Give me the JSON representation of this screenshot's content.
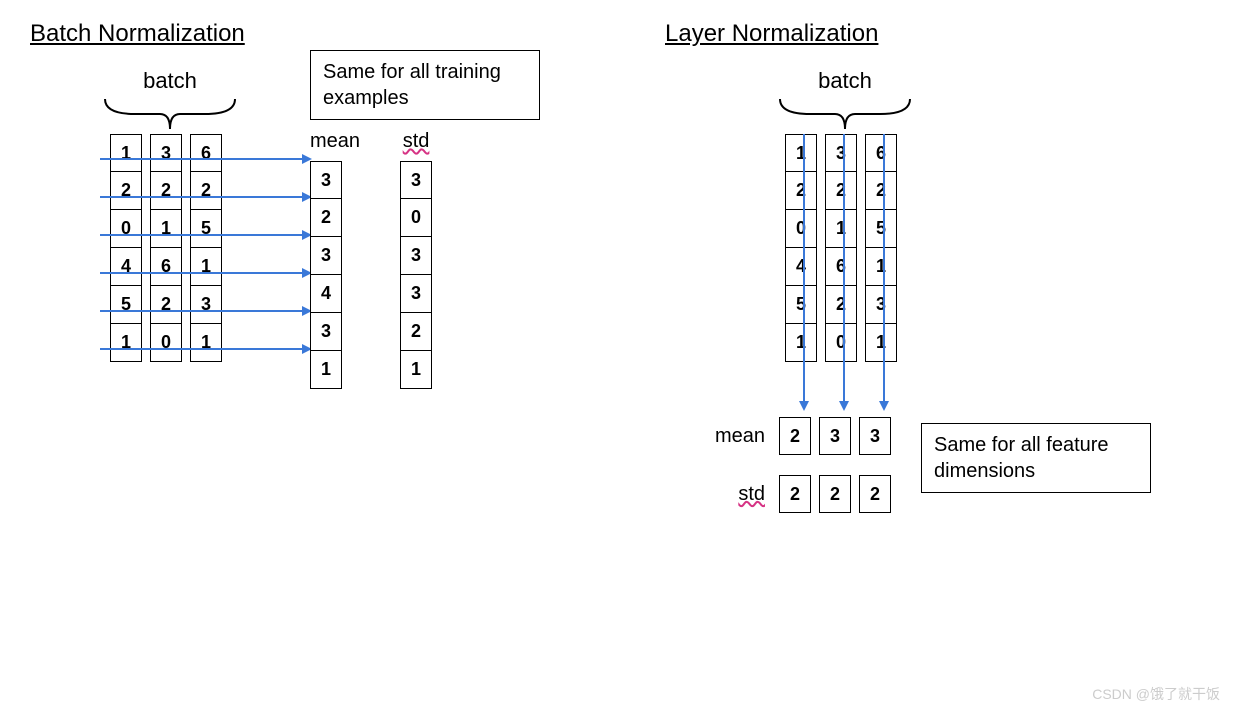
{
  "batch_norm": {
    "title": "Batch Normalization",
    "batch_label": "batch",
    "note": "Same for all training examples",
    "mean_label": "mean",
    "std_label": "std",
    "columns": [
      [
        "1",
        "2",
        "0",
        "4",
        "5",
        "1"
      ],
      [
        "3",
        "2",
        "1",
        "6",
        "2",
        "0"
      ],
      [
        "6",
        "2",
        "5",
        "1",
        "3",
        "1"
      ]
    ],
    "mean": [
      "3",
      "2",
      "3",
      "4",
      "3",
      "1"
    ],
    "std": [
      "3",
      "0",
      "3",
      "3",
      "2",
      "1"
    ]
  },
  "layer_norm": {
    "title": "Layer Normalization",
    "batch_label": "batch",
    "note": "Same for all feature dimensions",
    "mean_label": "mean",
    "std_label": "std",
    "columns": [
      [
        "1",
        "2",
        "0",
        "4",
        "5",
        "1"
      ],
      [
        "3",
        "2",
        "1",
        "6",
        "2",
        "0"
      ],
      [
        "6",
        "2",
        "5",
        "1",
        "3",
        "1"
      ]
    ],
    "mean": [
      "2",
      "3",
      "3"
    ],
    "std": [
      "2",
      "2",
      "2"
    ]
  },
  "watermark": "CSDN @饿了就干饭",
  "chart_data": {
    "type": "table",
    "batch_matrix": [
      [
        1,
        3,
        6
      ],
      [
        2,
        2,
        2
      ],
      [
        0,
        1,
        5
      ],
      [
        4,
        6,
        1
      ],
      [
        5,
        2,
        3
      ],
      [
        1,
        0,
        1
      ]
    ],
    "batch_norm_mean_per_row": [
      3,
      2,
      3,
      4,
      3,
      1
    ],
    "batch_norm_std_per_row": [
      3,
      0,
      3,
      3,
      2,
      1
    ],
    "layer_norm_mean_per_col": [
      2,
      3,
      3
    ],
    "layer_norm_std_per_col": [
      2,
      2,
      2
    ]
  }
}
